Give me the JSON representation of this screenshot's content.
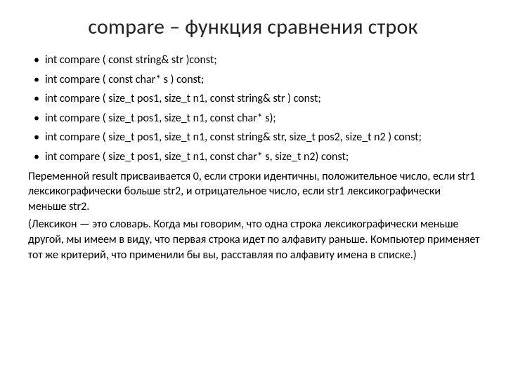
{
  "title": "compare – функция сравнения строк",
  "bullets": [
    "int compare ( const string& str )const;",
    "int compare ( const char* s ) const;",
    "int compare ( size_t pos1, size_t n1, const string& str ) const;",
    "int compare ( size_t pos1, size_t n1, const char* s);",
    "int compare ( size_t pos1, size_t n1, const string& str, size_t pos2, size_t n2 ) const;",
    "int compare ( size_t pos1, size_t n1, const char* s, size_t n2) const;"
  ],
  "para1": "Переменной result присваивается 0, если строки идентичны,  положительное число, если str1 лексикографически больше str2, и  отрицательное число, если str1 лексикографически меньше str2.",
  "para2": "(Лексикон — это словарь. Когда мы  говорим, что одна строка лексикографически меньше другой, мы имеем в виду, что первая строка идет по алфавиту раньше. Компьютер применяет тот же критерий, что применили бы вы, расставляя по алфавиту имена в списке.)"
}
